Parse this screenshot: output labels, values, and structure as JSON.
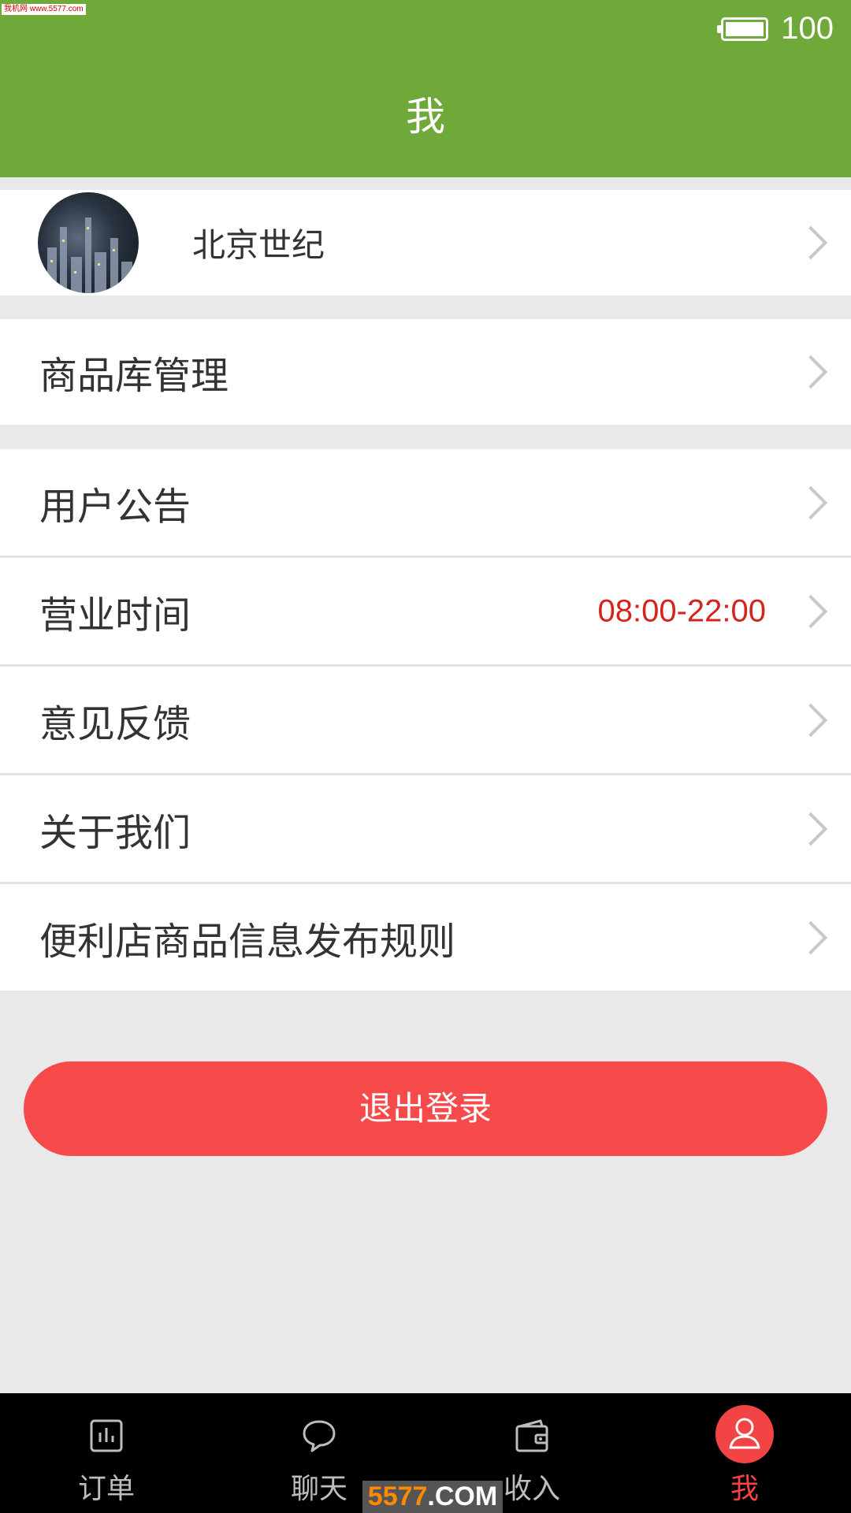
{
  "watermark": {
    "top": "我机网 www.5577.com",
    "bottom_accent": "5577",
    "bottom_rest": ".COM"
  },
  "status_bar": {
    "battery_level": 100,
    "battery_text": "100"
  },
  "header": {
    "title": "我"
  },
  "profile": {
    "name": "北京世纪"
  },
  "menu": {
    "product_library": "商品库管理",
    "items": [
      {
        "label": "用户公告"
      },
      {
        "label": "营业时间",
        "value": "08:00-22:00"
      },
      {
        "label": "意见反馈"
      },
      {
        "label": "关于我们"
      },
      {
        "label": "便利店商品信息发布规则"
      }
    ]
  },
  "logout_label": "退出登录",
  "tabs": [
    {
      "label": "订单",
      "icon": "chart-icon"
    },
    {
      "label": "聊天",
      "icon": "chat-bubble-icon"
    },
    {
      "label": "收入",
      "icon": "wallet-icon"
    },
    {
      "label": "我",
      "icon": "user-icon",
      "active": true
    }
  ],
  "colors": {
    "header": "#6ea93a",
    "accent_red": "#f74a4a",
    "hours_red": "#d4251c",
    "tab_active": "#f24444"
  }
}
